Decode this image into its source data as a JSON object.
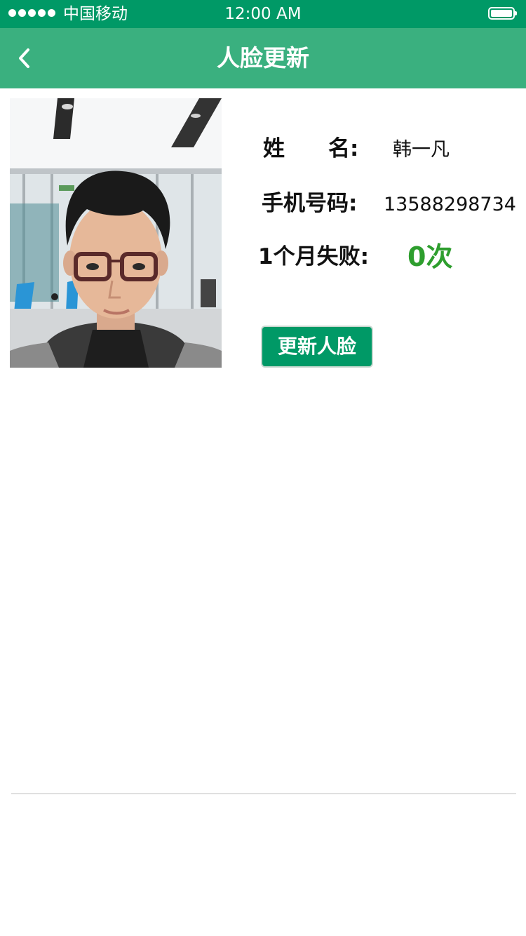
{
  "status_bar": {
    "carrier": "中国移动",
    "time": "12:00 AM",
    "battery_level": 1.0
  },
  "nav": {
    "title": "人脸更新",
    "back_icon": "chevron-left-icon"
  },
  "profile": {
    "name_label": "姓　　名:",
    "name_value": "韩一凡",
    "phone_label": "手机号码:",
    "phone_value": "13588298734",
    "fail_label": "1个月失败:",
    "fail_value": "0次"
  },
  "actions": {
    "update_button": "更新人脸"
  },
  "colors": {
    "status_bar": "#009966",
    "nav_bar": "#3ab07f",
    "fail_count": "#2e9e2e",
    "button": "#009966"
  }
}
